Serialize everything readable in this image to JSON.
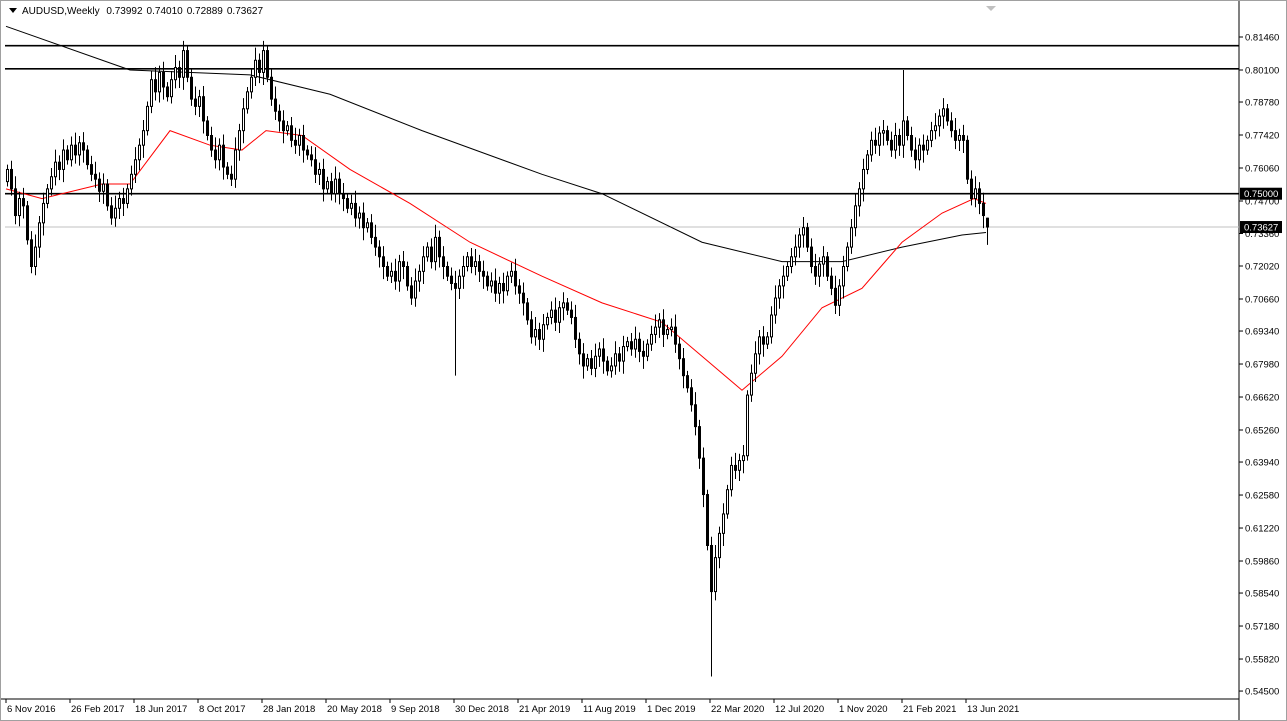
{
  "header": {
    "symbol_timeframe": "AUDUSD,Weekly",
    "open": "0.73992",
    "high": "0.74010",
    "low": "0.72889",
    "close": "0.73627"
  },
  "colors": {
    "bull_body": "#ffffff",
    "bear_body": "#000000",
    "ma_fast": "#ff0000",
    "ma_slow": "#000000",
    "level": "#000000",
    "price_line": "#c0c0c0"
  },
  "chart_data": {
    "type": "candlestick",
    "title": "AUDUSD,Weekly",
    "ylim": [
      0.545,
      0.8146
    ],
    "y_ticks": [
      "0.81460",
      "0.80100",
      "0.78780",
      "0.77420",
      "0.76060",
      "0.74700",
      "0.73360",
      "0.72020",
      "0.70660",
      "0.69340",
      "0.67980",
      "0.66620",
      "0.65260",
      "0.63940",
      "0.62580",
      "0.61220",
      "0.59860",
      "0.58540",
      "0.57180",
      "0.55820",
      "0.54500"
    ],
    "x_ticks": [
      {
        "label": "6 Nov 2016",
        "week": 0
      },
      {
        "label": "26 Feb 2017",
        "week": 16
      },
      {
        "label": "18 Jun 2017",
        "week": 32
      },
      {
        "label": "8 Oct 2017",
        "week": 48
      },
      {
        "label": "28 Jan 2018",
        "week": 64
      },
      {
        "label": "20 May 2018",
        "week": 80
      },
      {
        "label": "9 Sep 2018",
        "week": 96
      },
      {
        "label": "30 Dec 2018",
        "week": 112
      },
      {
        "label": "21 Apr 2019",
        "week": 128
      },
      {
        "label": "11 Aug 2019",
        "week": 144
      },
      {
        "label": "1 Dec 2019",
        "week": 160
      },
      {
        "label": "22 Mar 2020",
        "week": 176
      },
      {
        "label": "12 Jul 2020",
        "week": 192
      },
      {
        "label": "1 Nov 2020",
        "week": 208
      },
      {
        "label": "21 Feb 2021",
        "week": 224
      },
      {
        "label": "13 Jun 2021",
        "week": 240
      }
    ],
    "weekly_closes": [
      0.76,
      0.752,
      0.741,
      0.748,
      0.745,
      0.731,
      0.72,
      0.728,
      0.738,
      0.746,
      0.752,
      0.757,
      0.763,
      0.76,
      0.768,
      0.764,
      0.77,
      0.766,
      0.771,
      0.768,
      0.762,
      0.758,
      0.756,
      0.751,
      0.754,
      0.745,
      0.74,
      0.744,
      0.748,
      0.746,
      0.752,
      0.758,
      0.764,
      0.77,
      0.776,
      0.786,
      0.797,
      0.792,
      0.8,
      0.794,
      0.79,
      0.797,
      0.802,
      0.798,
      0.809,
      0.798,
      0.789,
      0.786,
      0.79,
      0.78,
      0.774,
      0.768,
      0.764,
      0.77,
      0.761,
      0.758,
      0.756,
      0.768,
      0.776,
      0.785,
      0.792,
      0.798,
      0.805,
      0.8,
      0.809,
      0.798,
      0.789,
      0.784,
      0.78,
      0.776,
      0.778,
      0.772,
      0.77,
      0.774,
      0.768,
      0.766,
      0.764,
      0.758,
      0.76,
      0.752,
      0.755,
      0.75,
      0.756,
      0.75,
      0.748,
      0.744,
      0.746,
      0.74,
      0.742,
      0.736,
      0.738,
      0.732,
      0.728,
      0.724,
      0.72,
      0.716,
      0.718,
      0.714,
      0.722,
      0.72,
      0.712,
      0.707,
      0.714,
      0.718,
      0.724,
      0.728,
      0.722,
      0.732,
      0.724,
      0.72,
      0.716,
      0.713,
      0.711,
      0.716,
      0.72,
      0.724,
      0.72,
      0.722,
      0.718,
      0.716,
      0.712,
      0.714,
      0.709,
      0.713,
      0.71,
      0.716,
      0.718,
      0.712,
      0.709,
      0.705,
      0.698,
      0.691,
      0.694,
      0.69,
      0.696,
      0.699,
      0.702,
      0.697,
      0.703,
      0.705,
      0.702,
      0.699,
      0.69,
      0.684,
      0.679,
      0.682,
      0.678,
      0.683,
      0.686,
      0.681,
      0.677,
      0.679,
      0.684,
      0.681,
      0.687,
      0.689,
      0.686,
      0.69,
      0.685,
      0.683,
      0.688,
      0.692,
      0.695,
      0.698,
      0.692,
      0.694,
      0.695,
      0.688,
      0.682,
      0.675,
      0.67,
      0.663,
      0.654,
      0.641,
      0.626,
      0.605,
      0.586,
      0.6,
      0.61,
      0.618,
      0.628,
      0.638,
      0.636,
      0.64,
      0.642,
      0.667,
      0.676,
      0.684,
      0.691,
      0.688,
      0.691,
      0.7,
      0.707,
      0.712,
      0.716,
      0.72,
      0.724,
      0.728,
      0.733,
      0.736,
      0.728,
      0.72,
      0.716,
      0.721,
      0.724,
      0.716,
      0.711,
      0.704,
      0.712,
      0.72,
      0.728,
      0.736,
      0.745,
      0.752,
      0.76,
      0.766,
      0.772,
      0.77,
      0.775,
      0.776,
      0.772,
      0.768,
      0.774,
      0.77,
      0.78,
      0.774,
      0.768,
      0.764,
      0.77,
      0.768,
      0.772,
      0.776,
      0.778,
      0.782,
      0.785,
      0.78,
      0.776,
      0.772,
      0.774,
      0.772,
      0.756,
      0.748,
      0.752,
      0.746,
      0.741,
      0.73627
    ],
    "first_open": 0.755,
    "last_candle": {
      "open": 0.73992,
      "high": 0.7401,
      "low": 0.72889,
      "close": 0.73627
    },
    "notable_wicks": [
      {
        "week": 112,
        "low": 0.675
      },
      {
        "week": 176,
        "low": 0.551
      },
      {
        "week": 224,
        "high": 0.801
      },
      {
        "week": 44,
        "high": 0.813
      },
      {
        "week": 64,
        "high": 0.813
      }
    ],
    "ma_fast": [
      [
        0,
        0.752
      ],
      [
        9,
        0.748
      ],
      [
        24,
        0.754
      ],
      [
        31,
        0.754
      ],
      [
        41,
        0.776
      ],
      [
        51,
        0.77
      ],
      [
        59,
        0.768
      ],
      [
        65,
        0.776
      ],
      [
        74,
        0.774
      ],
      [
        86,
        0.76
      ],
      [
        101,
        0.746
      ],
      [
        116,
        0.73
      ],
      [
        134,
        0.716
      ],
      [
        149,
        0.705
      ],
      [
        164,
        0.697
      ],
      [
        174,
        0.683
      ],
      [
        184,
        0.669
      ],
      [
        194,
        0.683
      ],
      [
        204,
        0.703
      ],
      [
        214,
        0.711
      ],
      [
        224,
        0.73
      ],
      [
        234,
        0.742
      ],
      [
        242,
        0.748
      ],
      [
        245,
        0.746
      ]
    ],
    "ma_slow": [
      [
        0,
        0.819
      ],
      [
        31,
        0.801
      ],
      [
        61,
        0.799
      ],
      [
        81,
        0.791
      ],
      [
        104,
        0.776
      ],
      [
        134,
        0.758
      ],
      [
        149,
        0.75
      ],
      [
        174,
        0.73
      ],
      [
        194,
        0.722
      ],
      [
        209,
        0.722
      ],
      [
        224,
        0.728
      ],
      [
        239,
        0.733
      ],
      [
        245,
        0.734
      ]
    ],
    "levels": [
      0.811,
      0.8015,
      0.75
    ],
    "level_labels": {
      "0.7500": "0.75000"
    },
    "current_price": 0.73627,
    "current_price_label": "0.73627"
  }
}
